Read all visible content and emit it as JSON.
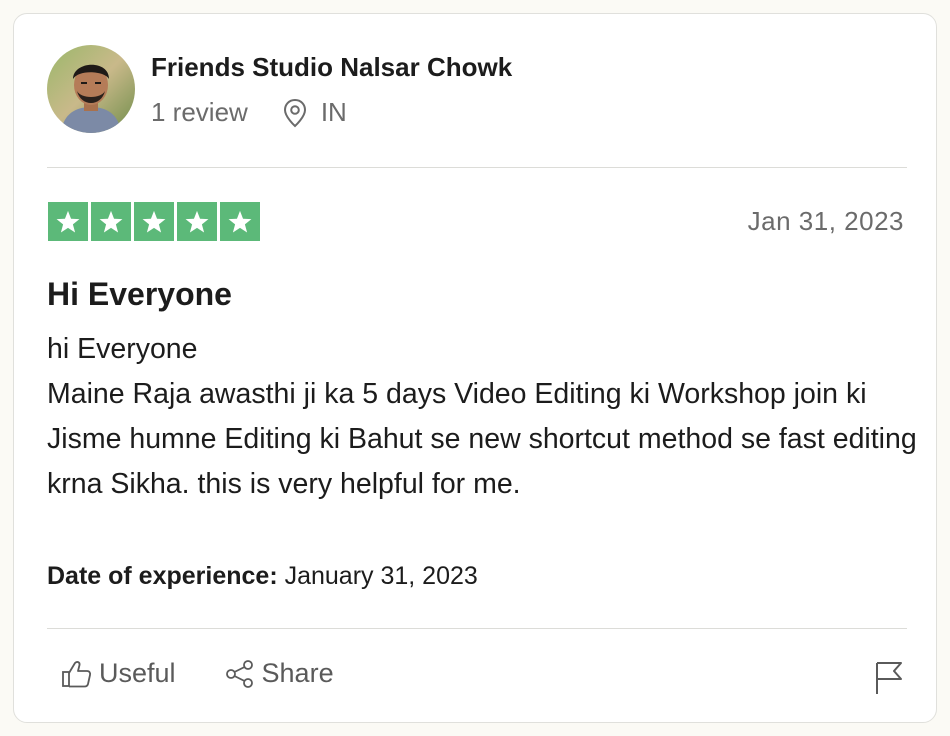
{
  "reviewer": {
    "name": "Friends Studio Nalsar Chowk",
    "review_count": "1 review",
    "location": "IN",
    "avatar_icon": "avatar-photo",
    "location_icon": "map-pin-icon"
  },
  "review": {
    "rating": 5,
    "max_rating": 5,
    "star_color": "#5cb979",
    "date": "Jan 31, 2023",
    "title": "Hi Everyone",
    "body": "hi Everyone\nMaine Raja awasthi ji ka 5 days Video Editing ki Workshop join ki Jisme humne Editing ki Bahut se new shortcut method se fast editing krna Sikha. this is very helpful for me.",
    "experience_label": "Date of experience:",
    "experience_date": "January 31, 2023"
  },
  "actions": {
    "useful_label": "Useful",
    "useful_icon": "thumbs-up-icon",
    "share_label": "Share",
    "share_icon": "share-icon",
    "flag_icon": "flag-icon"
  }
}
